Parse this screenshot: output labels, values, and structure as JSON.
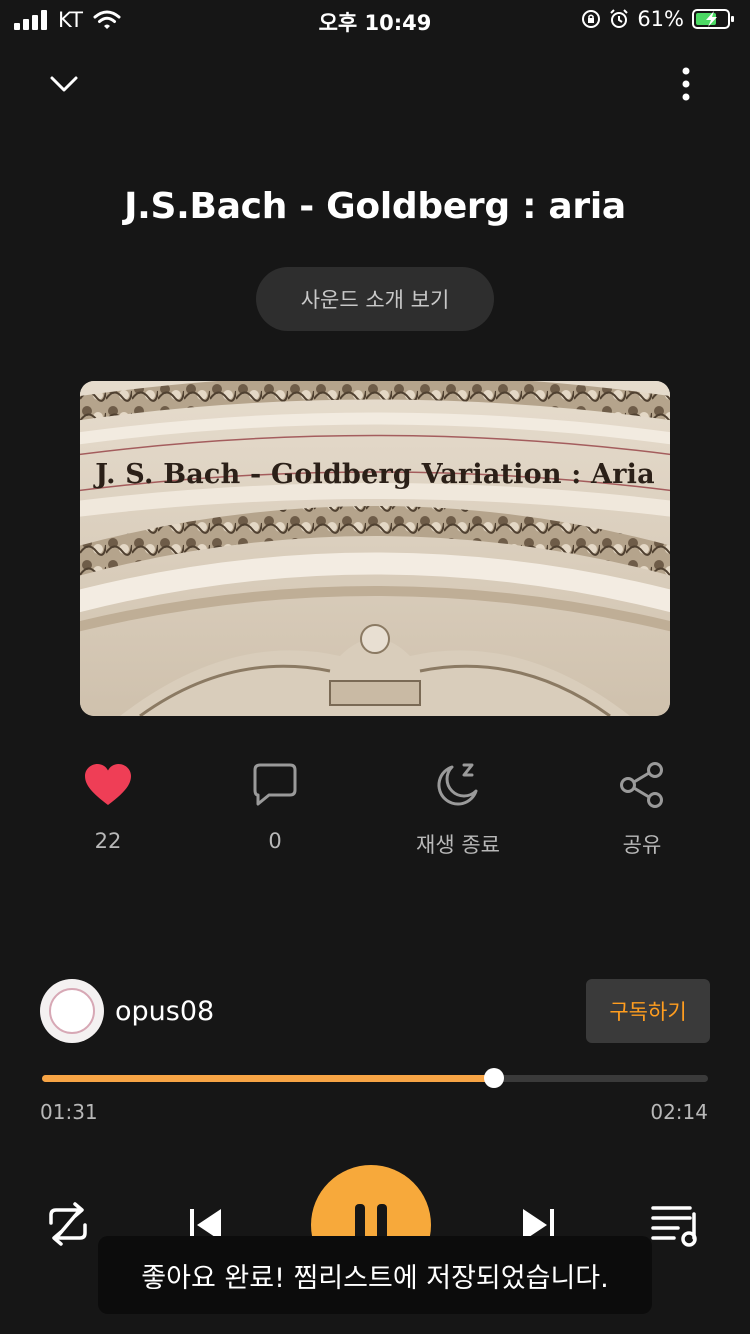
{
  "status_bar": {
    "carrier": "KT",
    "time": "오후 10:49",
    "battery": "61%"
  },
  "header": {
    "collapse_icon": "chevron-down-icon",
    "more_icon": "more-vertical-icon"
  },
  "track": {
    "title": "J.S.Bach - Goldberg : aria",
    "intro_button": "사운드 소개 보기",
    "artwork_text": "J. S. Bach - Goldberg Variation : Aria"
  },
  "actions": {
    "like": {
      "icon": "heart-icon",
      "label": "22",
      "color": "#ef3e56"
    },
    "comment": {
      "icon": "comment-icon",
      "label": "0"
    },
    "sleep": {
      "icon": "sleep-timer-icon",
      "label": "재생 종료"
    },
    "share": {
      "icon": "share-icon",
      "label": "공유"
    }
  },
  "creator": {
    "name": "opus08",
    "subscribe_label": "구독하기"
  },
  "player": {
    "current_time": "01:31",
    "total_time": "02:14",
    "progress": 0.679,
    "accent_color": "#f7a93b",
    "controls": [
      "repeat-icon",
      "skip-previous-icon",
      "pause-icon",
      "skip-next-icon",
      "playlist-icon"
    ]
  },
  "toast": {
    "message": "좋아요 완료! 찜리스트에 저장되었습니다."
  }
}
